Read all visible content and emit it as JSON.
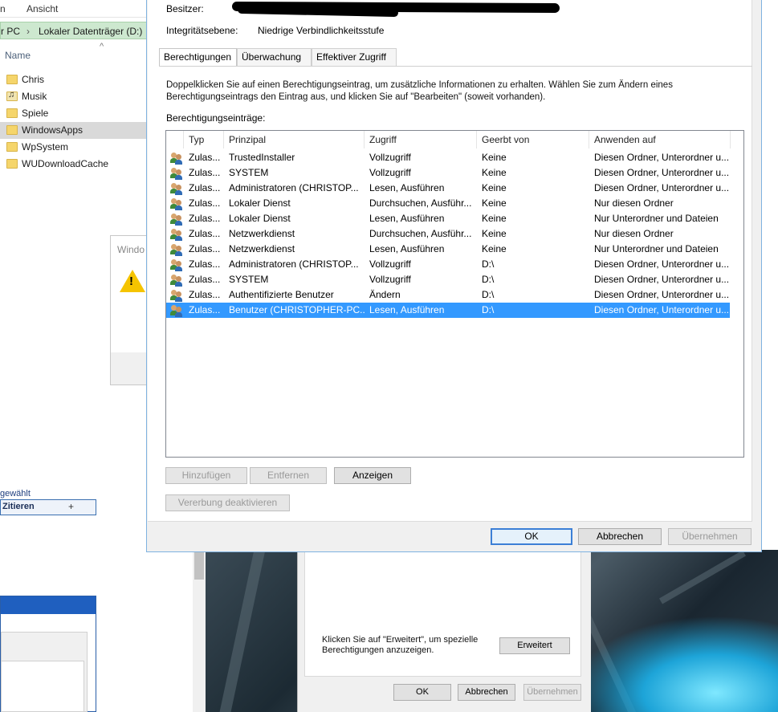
{
  "explorer": {
    "menu_left": "n",
    "menu_view": "Ansicht",
    "breadcrumb_pc": "r PC",
    "breadcrumb_drive": "Lokaler Datenträger (D:)",
    "column_name": "Name",
    "sort_arrow": "^",
    "items": [
      {
        "label": "Chris",
        "icon": "folder-icon"
      },
      {
        "label": "Musik",
        "icon": "music-folder-icon"
      },
      {
        "label": "Spiele",
        "icon": "folder-icon"
      },
      {
        "label": "WindowsApps",
        "icon": "folder-icon",
        "selected": true
      },
      {
        "label": "WpSystem",
        "icon": "folder-icon"
      },
      {
        "label": "WUDownloadCache",
        "icon": "folder-icon"
      }
    ],
    "status": "gewählt"
  },
  "forum": {
    "cite_label": "Zitieren",
    "cite_icon": "+"
  },
  "warn_dialog": {
    "title": "Windo",
    "icon": "warning-icon"
  },
  "security_dialog": {
    "owner_label": "Besitzer:",
    "integrity_label": "Integritätsebene:",
    "integrity_value": "Niedrige Verbindlichkeitsstufe",
    "tabs": [
      "Berechtigungen",
      "Überwachung",
      "Effektiver Zugriff"
    ],
    "instruction": "Doppelklicken Sie auf einen Berechtigungseintrag, um zusätzliche Informationen zu erhalten. Wählen Sie zum Ändern eines Berechtigungseintrags den Eintrag aus, und klicken Sie auf \"Bearbeiten\" (soweit vorhanden).",
    "entries_label": "Berechtigungseinträge:",
    "columns": [
      "Typ",
      "Prinzipal",
      "Zugriff",
      "Geerbt von",
      "Anwenden auf"
    ],
    "rows": [
      [
        "Zulas...",
        "TrustedInstaller",
        "Vollzugriff",
        "Keine",
        "Diesen Ordner, Unterordner u..."
      ],
      [
        "Zulas...",
        "SYSTEM",
        "Vollzugriff",
        "Keine",
        "Diesen Ordner, Unterordner u..."
      ],
      [
        "Zulas...",
        "Administratoren (CHRISTOP...",
        "Lesen, Ausführen",
        "Keine",
        "Diesen Ordner, Unterordner u..."
      ],
      [
        "Zulas...",
        "Lokaler Dienst",
        "Durchsuchen, Ausführ...",
        "Keine",
        "Nur diesen Ordner"
      ],
      [
        "Zulas...",
        "Lokaler Dienst",
        "Lesen, Ausführen",
        "Keine",
        "Nur Unterordner und Dateien"
      ],
      [
        "Zulas...",
        "Netzwerkdienst",
        "Durchsuchen, Ausführ...",
        "Keine",
        "Nur diesen Ordner"
      ],
      [
        "Zulas...",
        "Netzwerkdienst",
        "Lesen, Ausführen",
        "Keine",
        "Nur Unterordner und Dateien"
      ],
      [
        "Zulas...",
        "Administratoren (CHRISTOP...",
        "Vollzugriff",
        "D:\\",
        "Diesen Ordner, Unterordner u..."
      ],
      [
        "Zulas...",
        "SYSTEM",
        "Vollzugriff",
        "D:\\",
        "Diesen Ordner, Unterordner u..."
      ],
      [
        "Zulas...",
        "Authentifizierte Benutzer",
        "Ändern",
        "D:\\",
        "Diesen Ordner, Unterordner u..."
      ],
      [
        "Zulas...",
        "Benutzer (CHRISTOPHER-PC...",
        "Lesen, Ausführen",
        "D:\\",
        "Diesen Ordner, Unterordner u..."
      ]
    ],
    "selected_row": 10,
    "buttons": {
      "add": "Hinzufügen",
      "remove": "Entfernen",
      "view": "Anzeigen",
      "disable_inheritance": "Vererbung deaktivieren",
      "ok": "OK",
      "cancel": "Abbrechen",
      "apply": "Übernehmen"
    }
  },
  "properties_dialog": {
    "hint": "Klicken Sie auf \"Erweitert\", um spezielle Berechtigungen anzuzeigen.",
    "advanced": "Erweitert",
    "ok": "OK",
    "cancel": "Abbrechen",
    "apply": "Übernehmen"
  },
  "colors": {
    "selection": "#3399ff",
    "default_button_border": "#3c7fd6",
    "address_bar": "#cde8cf"
  }
}
